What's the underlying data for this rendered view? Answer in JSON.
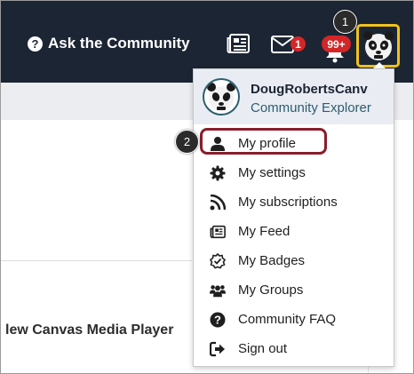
{
  "header": {
    "ask_label": "Ask the Community",
    "mail_count": "1",
    "notification_count": "99+"
  },
  "steps": {
    "one": "1",
    "two": "2"
  },
  "menu": {
    "user_name": "DougRobertsCanv",
    "user_role": "Community Explorer",
    "items": [
      {
        "label": "My profile",
        "icon": "user-icon"
      },
      {
        "label": "My settings",
        "icon": "gear-icon"
      },
      {
        "label": "My subscriptions",
        "icon": "rss-icon"
      },
      {
        "label": "My Feed",
        "icon": "newspaper-icon"
      },
      {
        "label": "My Badges",
        "icon": "badge-check-icon"
      },
      {
        "label": "My Groups",
        "icon": "users-icon"
      },
      {
        "label": "Community FAQ",
        "icon": "question-circle-icon"
      },
      {
        "label": "Sign out",
        "icon": "sign-out-icon"
      }
    ]
  },
  "page": {
    "title": "lew Canvas Media Player"
  },
  "colors": {
    "header_bg": "#1c2533",
    "badge": "#d22628",
    "avatar_highlight": "#f1c21b",
    "menu_highlight": "#8b1d2c",
    "role_text": "#2c5e70"
  }
}
